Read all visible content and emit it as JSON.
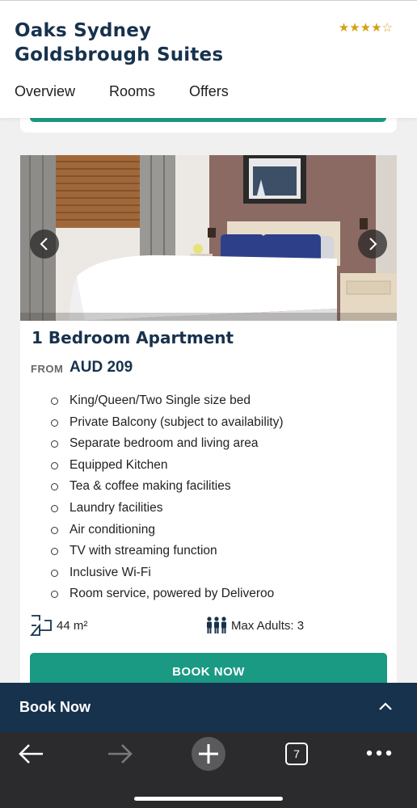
{
  "header": {
    "hotel_name": "Oaks Sydney Goldsbrough Suites",
    "stars": "★★★★☆"
  },
  "nav": {
    "tabs": [
      "Overview",
      "Rooms",
      "Offers"
    ]
  },
  "room": {
    "title": "1 Bedroom Apartment",
    "from_label": "FROM",
    "price": "AUD 209",
    "amenities": [
      "King/Queen/Two Single size bed",
      "Private Balcony (subject to availability)",
      "Separate bedroom and living area",
      "Equipped Kitchen",
      "Tea & coffee making facilities",
      "Laundry facilities",
      "Air conditioning",
      "TV with streaming function",
      "Inclusive Wi-Fi",
      "Room service, powered by Deliveroo"
    ],
    "size": "44 m²",
    "max_adults": "Max Adults: 3",
    "book_label": "BOOK NOW"
  },
  "book_bar": {
    "label": "Book Now"
  },
  "browser": {
    "tab_count": "7"
  },
  "colors": {
    "navy": "#17324d",
    "teal": "#1a9a83",
    "star_gold": "#d4a017"
  }
}
